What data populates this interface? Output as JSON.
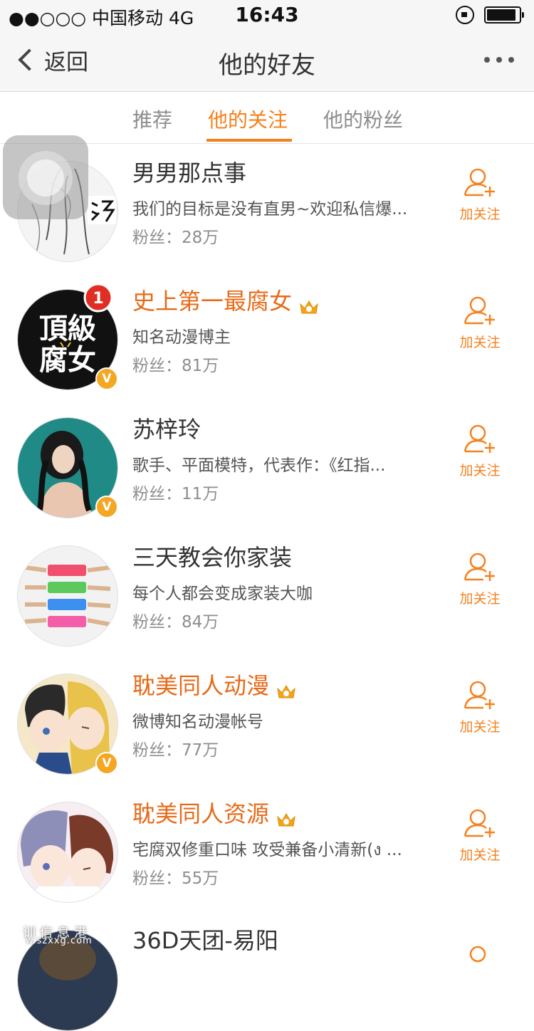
{
  "status_bar": {
    "carrier": "●●○○○ 中国移动  4G",
    "time": "16:43"
  },
  "nav": {
    "back_label": "返回",
    "title": "他的好友"
  },
  "tabs": [
    {
      "label": "推荐",
      "active": false
    },
    {
      "label": "他的关注",
      "active": true
    },
    {
      "label": "他的粉丝",
      "active": false
    }
  ],
  "accent_color": "#f5811d",
  "follow_label": "加关注",
  "users": [
    {
      "name": "男男那点事",
      "vip": false,
      "verified": false,
      "desc": "我们的目标是没有直男~欢迎私信爆...",
      "fans": "粉丝：28万",
      "avatar": "sketch-illustration"
    },
    {
      "name": "史上第一最腐女",
      "vip": true,
      "verified": true,
      "desc": "知名动漫博主",
      "fans": "粉丝：81万",
      "avatar": "text-logo",
      "avatar_text": [
        "頂級",
        "腐女"
      ],
      "badge": "1"
    },
    {
      "name": "苏梓玲",
      "vip": false,
      "verified": true,
      "desc": "歌手、平面模特，代表作：《红指...",
      "fans": "粉丝：11万",
      "avatar": "photo-portrait"
    },
    {
      "name": "三天教会你家装",
      "vip": false,
      "verified": false,
      "desc": "每个人都会变成家装大咖",
      "fans": "粉丝：84万",
      "avatar": "paint-swatches"
    },
    {
      "name": "耽美同人动漫",
      "vip": true,
      "verified": true,
      "desc": "微博知名动漫帐号",
      "fans": "粉丝：77万",
      "avatar": "anime-pair"
    },
    {
      "name": "耽美同人资源",
      "vip": true,
      "verified": false,
      "desc": "宅腐双修重口味 攻受兼备小清新(ง ...",
      "fans": "粉丝：55万",
      "avatar": "anime-pair-2"
    },
    {
      "name": "36D天团-易阳",
      "vip": false,
      "verified": false,
      "desc": "",
      "fans": "",
      "avatar": "photo-dark"
    }
  ],
  "watermark": {
    "text": "训信息港",
    "url": "w.szxxg.com"
  }
}
